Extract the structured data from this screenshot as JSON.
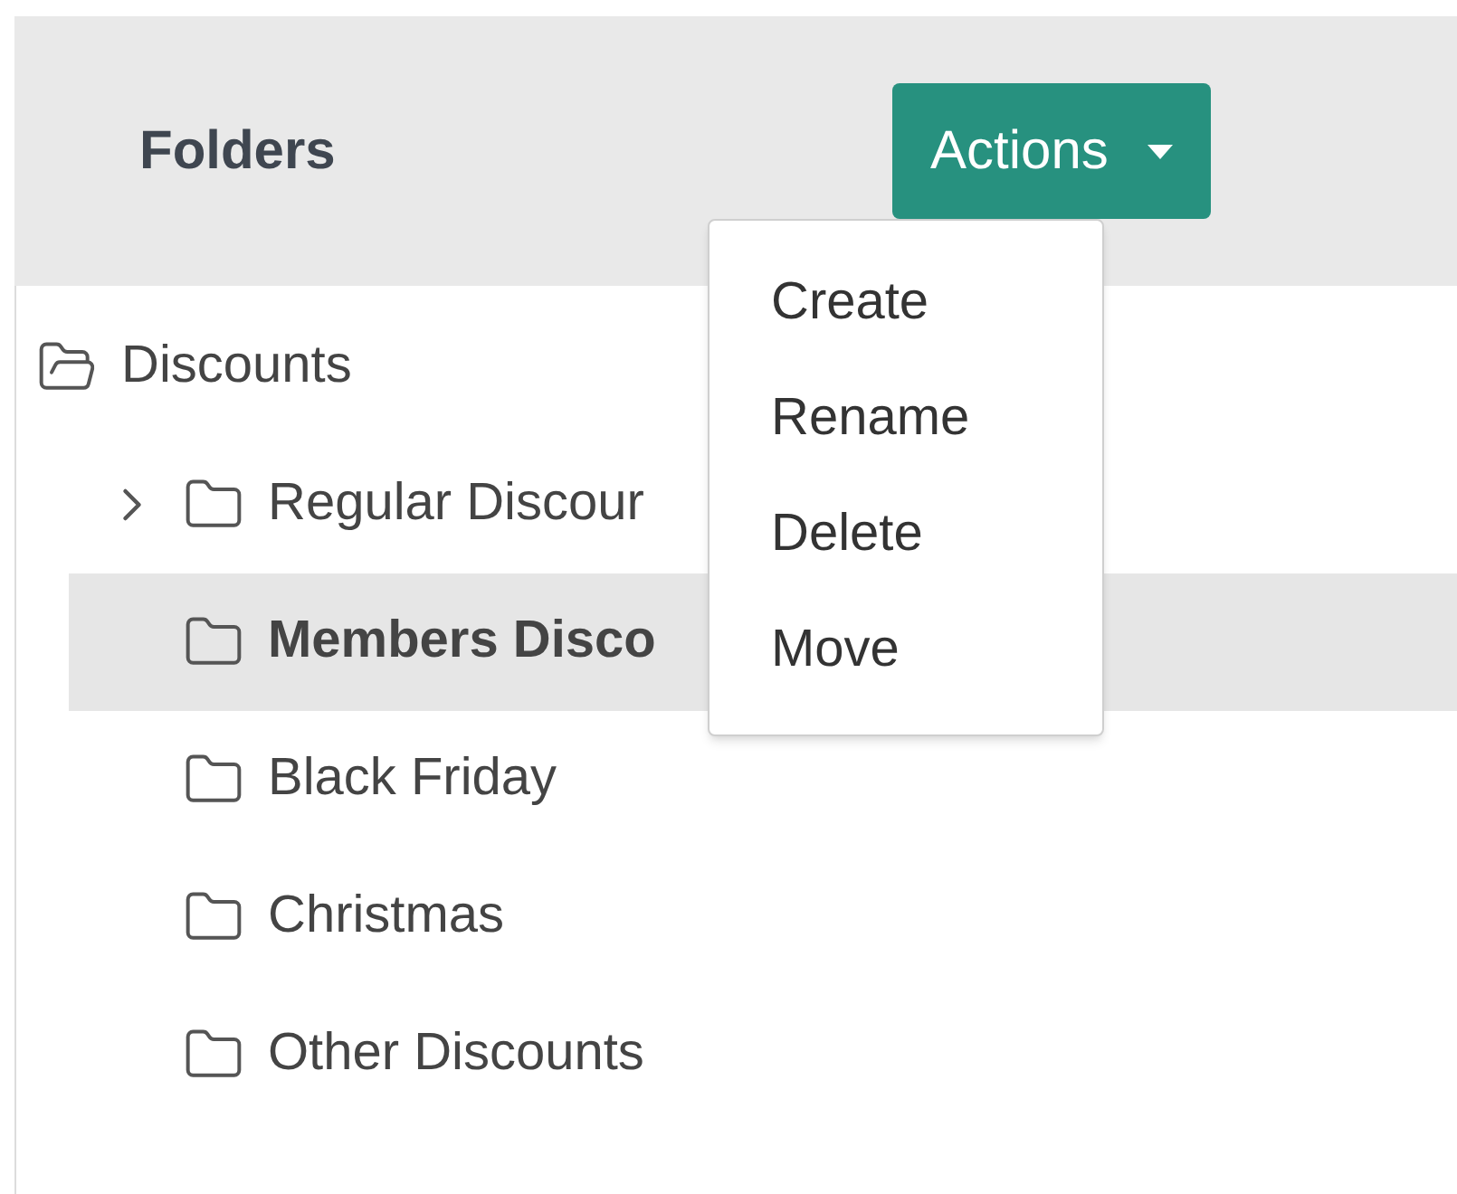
{
  "header": {
    "title": "Folders",
    "actions_button": "Actions"
  },
  "actions_menu": {
    "open": true,
    "items": [
      "Create",
      "Rename",
      "Delete",
      "Move"
    ]
  },
  "tree": [
    {
      "label": "Discounts",
      "expanded": true,
      "selected": false,
      "children": [
        {
          "label": "Regular Discour",
          "expanded": false,
          "selected": false
        },
        {
          "label": "Members Disco",
          "selected": true
        },
        {
          "label": "Black Friday",
          "selected": false
        },
        {
          "label": "Christmas",
          "selected": false
        },
        {
          "label": "Other Discounts",
          "selected": false
        }
      ]
    }
  ]
}
